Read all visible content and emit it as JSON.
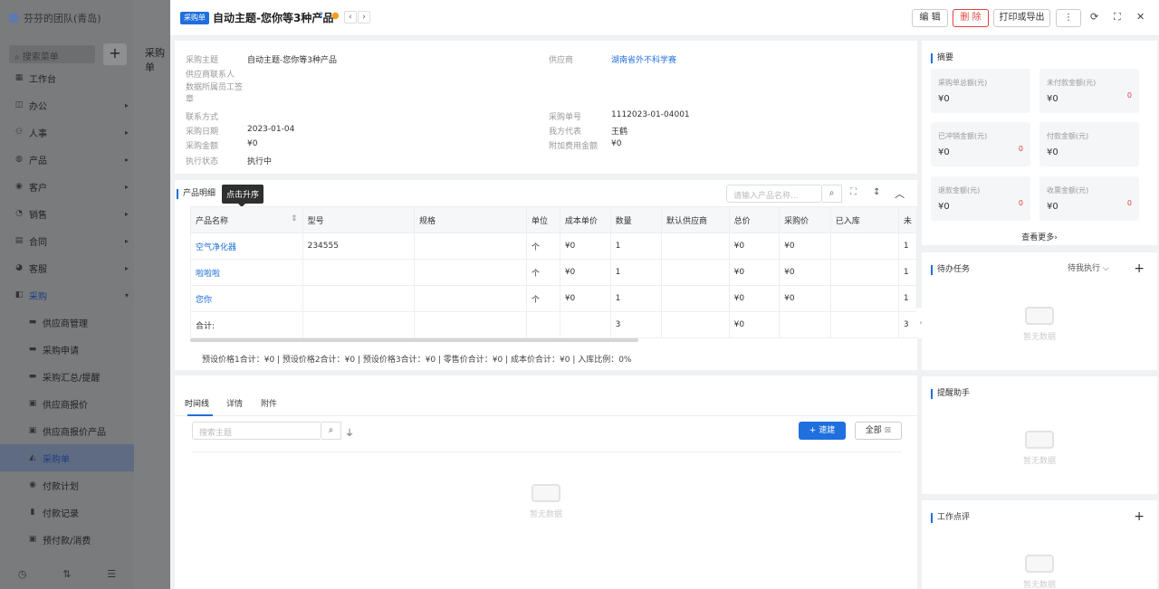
{
  "sidebar": {
    "team": "芬芬的团队(青岛)",
    "search_placeholder": "搜索菜单",
    "add": "+",
    "items": [
      {
        "label": "工作台",
        "icon": "▦"
      },
      {
        "label": "办公",
        "icon": "◫"
      },
      {
        "label": "人事",
        "icon": "⚇"
      },
      {
        "label": "产品",
        "icon": "◍"
      },
      {
        "label": "客户",
        "icon": "◉"
      },
      {
        "label": "销售",
        "icon": "◔"
      },
      {
        "label": "合同",
        "icon": "▤"
      },
      {
        "label": "客服",
        "icon": "◕"
      },
      {
        "label": "采购",
        "icon": "◧"
      }
    ],
    "subitems": [
      "供应商管理",
      "采购申请",
      "采购汇总/提醒",
      "供应商报价",
      "供应商报价产品",
      "采购单",
      "付款计划",
      "付款记录",
      "预付款/消费"
    ],
    "bottom": [
      "◷",
      "⇅",
      "☰"
    ]
  },
  "bg_page": {
    "title": "采购单"
  },
  "header": {
    "tag": "采购单",
    "title": "自动主题-您你等3种产品",
    "edit": "编 辑",
    "delete": "删 除",
    "print": "打印或导出",
    "more": "⋮",
    "prev": "‹",
    "next": "›"
  },
  "info": {
    "left": [
      {
        "label": "采购主题",
        "value": "自动主题-您你等3种产品"
      },
      {
        "label": "供应商联系人",
        "value": ""
      },
      {
        "label": "数据所属员工签章",
        "value": ""
      },
      {
        "label": "联系方式",
        "value": ""
      },
      {
        "label": "采购日期",
        "value": "2023-01-04"
      },
      {
        "label": "采购金额",
        "value": "¥0"
      },
      {
        "label": "执行状态",
        "value": "执行中"
      }
    ],
    "right": [
      {
        "label": "供应商",
        "value": "湖南省外不科学赛"
      },
      {
        "label": "采购单号",
        "value": "1112023-01-04001"
      },
      {
        "label": "我方代表",
        "value": "王鹤"
      },
      {
        "label": "附加费用金额",
        "value": "¥0"
      }
    ]
  },
  "products": {
    "title": "产品明细",
    "tooltip": "点击升序",
    "search_placeholder": "请输入产品名称...",
    "columns": [
      "产品名称",
      "型号",
      "规格",
      "单位",
      "成本单价",
      "数量",
      "默认供应商",
      "总价",
      "采购价",
      "已入库",
      "未"
    ],
    "rows": [
      [
        "空气净化器",
        "234555",
        "",
        "个",
        "¥0",
        "1",
        "",
        "¥0",
        "¥0",
        "",
        "1"
      ],
      [
        "啦啦啦",
        "",
        "",
        "个",
        "¥0",
        "1",
        "",
        "¥0",
        "¥0",
        "",
        "1"
      ],
      [
        "您你",
        "",
        "",
        "个",
        "¥0",
        "1",
        "",
        "¥0",
        "¥0",
        "",
        "1"
      ]
    ],
    "total": [
      "合计:",
      "",
      "",
      "",
      "",
      "3",
      "",
      "¥0",
      "",
      "",
      "3"
    ],
    "summary": "预设价格1合计：¥0 |   预设价格2合计：¥0 |   预设价格3合计：¥0 |   零售价合计：¥0 |   成本价合计：¥0 |   入库比例：0%"
  },
  "timeline": {
    "tabs": [
      "时间线",
      "详情",
      "附件"
    ],
    "search_placeholder": "搜索主题",
    "new": "+ 速建",
    "all": "全部",
    "empty": "暂无数据"
  },
  "summary": {
    "title": "摘要",
    "stats": [
      {
        "label": "采购单总额(元)",
        "value": "¥0",
        "extra": ""
      },
      {
        "label": "未付款金额(元)",
        "value": "¥0",
        "extra": "0"
      },
      {
        "label": "已冲销金额(元)",
        "value": "¥0",
        "extra": "0"
      },
      {
        "label": "付款金额(元)",
        "value": "¥0",
        "extra": ""
      },
      {
        "label": "退款金额(元)",
        "value": "¥0",
        "extra": "0"
      },
      {
        "label": "收票金额(元)",
        "value": "¥0",
        "extra": "0"
      }
    ],
    "more": "查看更多›"
  },
  "todo": {
    "title": "待办任务",
    "filter": "待我执行 ⌵",
    "empty": "暂无数据"
  },
  "reminder": {
    "title": "提醒助手",
    "empty": "暂无数据"
  },
  "comment": {
    "title": "工作点评",
    "empty": "暂无数据"
  }
}
